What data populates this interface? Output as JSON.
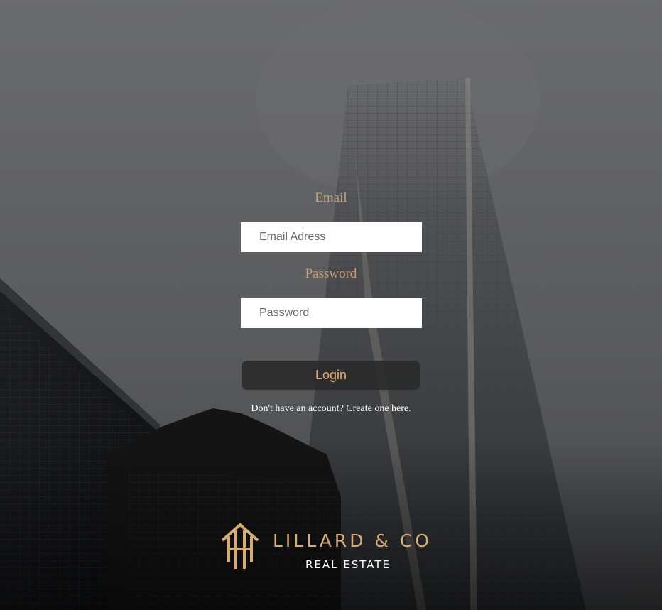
{
  "form": {
    "email_label": "Email",
    "email_placeholder": "Email Adress",
    "password_label": "Password",
    "password_placeholder": "Password",
    "login_label": "Login",
    "signup_text": "Don't have an account? Create one here."
  },
  "logo": {
    "name": "LILLARD & CO",
    "subtitle": "REAL ESTATE",
    "icon": "building-monogram-icon"
  },
  "colors": {
    "accent_gold": "#d7ad74",
    "label_tan": "#c2a178",
    "login_text": "#e8a96a"
  }
}
